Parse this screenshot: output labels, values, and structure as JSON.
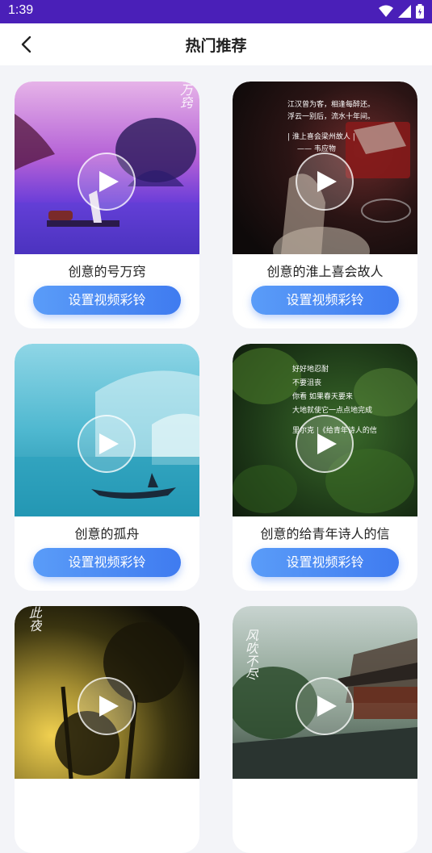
{
  "status": {
    "time": "1:39"
  },
  "header": {
    "title": "热门推荐"
  },
  "cards": [
    {
      "caption": "创意的号万窍",
      "button": "设置视频彩铃",
      "overlay": {
        "vertical": "万窍"
      }
    },
    {
      "caption": "创意的淮上喜会故人",
      "button": "设置视频彩铃",
      "overlay": {
        "line1": "江汉曾为客，相逢每醉还。",
        "line2": "浮云一别后，流水十年间。",
        "line3": "| 淮上喜会梁州故人 |",
        "line4": "—— 韦应物"
      }
    },
    {
      "caption": "创意的孤舟",
      "button": "设置视频彩铃"
    },
    {
      "caption": "创意的给青年诗人的信",
      "button": "设置视频彩铃",
      "overlay": {
        "line1": "好好地忍耐",
        "line2": "不要沮丧",
        "line3": "你看 如果春天要来",
        "line4": "大地就使它一点点地完成",
        "line5": "里尔克 |《给青年诗人的信"
      }
    },
    {
      "caption": "",
      "button": "",
      "overlay": {
        "vertical": "此夜"
      }
    },
    {
      "caption": "",
      "button": "",
      "overlay": {
        "vertical": "风吹不尽"
      }
    }
  ],
  "colors": {
    "statusbar": "#4a1fb8",
    "button": "#3f7bf0",
    "background": "#f3f4f8"
  }
}
